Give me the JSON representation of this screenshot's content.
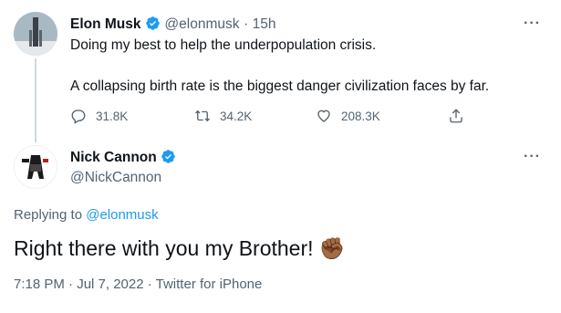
{
  "parent_tweet": {
    "author_name": "Elon Musk",
    "handle": "@elonmusk",
    "separator": "·",
    "time": "15h",
    "line1": "Doing my best to help the underpopulation crisis.",
    "line2": "A collapsing birth rate is the biggest danger civilization faces by far.",
    "replies": "31.8K",
    "retweets": "34.2K",
    "likes": "208.3K",
    "more": "···"
  },
  "reply_tweet": {
    "author_name": "Nick Cannon",
    "handle": "@NickCannon",
    "replying_prefix": "Replying to",
    "replying_to": "@elonmusk",
    "text": "Right there with you my Brother!",
    "emoji": "✊🏾",
    "timestamp": "7:18 PM · Jul 7, 2022 · Twitter for iPhone",
    "more": "···"
  },
  "colors": {
    "accent": "#1d9bf0",
    "muted": "#536471",
    "line": "#cfd9de"
  }
}
